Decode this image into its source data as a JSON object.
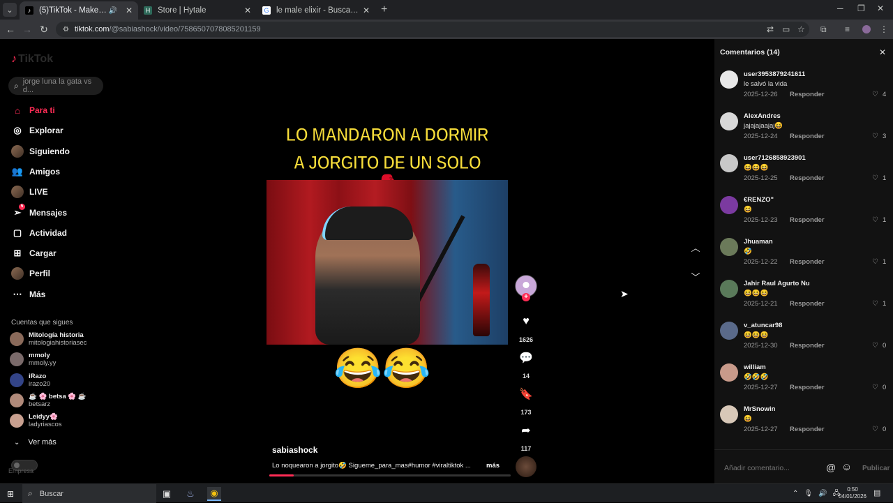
{
  "browser": {
    "tabs": [
      {
        "title": "(5)TikTok - Make Your Day",
        "fav": "♪",
        "fav_color": "#000000",
        "active": true,
        "audio": true
      },
      {
        "title": "Store | Hytale",
        "fav": "H",
        "fav_color": "#2e6a5a",
        "active": false
      },
      {
        "title": "le male elixir - Buscar con Goog",
        "fav": "G",
        "fav_color": "#ffffff",
        "active": false
      }
    ],
    "url_domain": "tiktok.com",
    "url_path": "/@sabiashock/video/7586507078085201159"
  },
  "sidebar": {
    "logo": "TikTok",
    "search_placeholder": "jorge luna la gata vs d...",
    "nav": [
      {
        "label": "Para ti",
        "icon": "home-icon",
        "active": true
      },
      {
        "label": "Explorar",
        "icon": "compass-icon"
      },
      {
        "label": "Siguiendo",
        "icon": "following-avatar-icon"
      },
      {
        "label": "Amigos",
        "icon": "friends-icon"
      },
      {
        "label": "LIVE",
        "icon": "live-avatar-icon"
      },
      {
        "label": "Mensajes",
        "icon": "messages-icon",
        "badge": "5"
      },
      {
        "label": "Actividad",
        "icon": "activity-icon"
      },
      {
        "label": "Cargar",
        "icon": "upload-icon"
      },
      {
        "label": "Perfil",
        "icon": "profile-avatar-icon"
      },
      {
        "label": "Más",
        "icon": "more-icon"
      }
    ],
    "following_title": "Cuentas que sigues",
    "following": [
      {
        "name": "Mitología historia",
        "handle": "mitologiahistoriasec"
      },
      {
        "name": "mmoly",
        "handle": "mmoly.yy"
      },
      {
        "name": "iRazo",
        "handle": "irazo20"
      },
      {
        "name": "☕ 🌸 betsa 🌸 ☕",
        "handle": "betsarz"
      },
      {
        "name": "Leidyy🌸",
        "handle": "ladyriascos"
      }
    ],
    "see_more": "Ver más",
    "footer": "Empresa"
  },
  "video": {
    "caption_line1": "LO MANDARON A DORMIR",
    "caption_line2": "A JORGITO DE UN SOLO 🥊",
    "emoji": "😂😂",
    "author": "sabiashock",
    "description": "Lo noquearon a jorgito🤣 Sigueme_para_mas#humor #viraltiktok ...",
    "more": "más",
    "likes": "1626",
    "comments": "14",
    "saves": "173",
    "shares": "117",
    "progress": 0.1
  },
  "comments": {
    "title": "Comentarios (14)",
    "items": [
      {
        "user": "user3953879241611",
        "text": "le salvó la vida",
        "date": "2025-12-26",
        "likes": "4",
        "avatar_color": "#e8e8e8"
      },
      {
        "user": "AlexAndres",
        "text": "jajajajaajaj😆",
        "date": "2025-12-24",
        "likes": "3",
        "avatar_color": "#d8d8d8"
      },
      {
        "user": "user7126858923901",
        "text": "😆😆😆",
        "date": "2025-12-25",
        "likes": "1",
        "avatar_color": "#c8c8c8"
      },
      {
        "user": "€RENZO\"",
        "text": "😆",
        "date": "2025-12-23",
        "likes": "1",
        "avatar_color": "#7b3aa0"
      },
      {
        "user": "Jhuaman",
        "text": "🤣",
        "date": "2025-12-22",
        "likes": "1",
        "avatar_color": "#6b7a5a"
      },
      {
        "user": "Jahir Raul Agurto Nu",
        "text": "😆😆😆",
        "date": "2025-12-21",
        "likes": "1",
        "avatar_color": "#5a7a5a"
      },
      {
        "user": "v_atuncar98",
        "text": "😆😆😆",
        "date": "2025-12-30",
        "likes": "0",
        "avatar_color": "#5a6a8a"
      },
      {
        "user": "william",
        "text": "🤣🤣🤣",
        "date": "2025-12-27",
        "likes": "0",
        "avatar_color": "#c89a8a"
      },
      {
        "user": "MrSnowin",
        "text": "😆",
        "date": "2025-12-27",
        "likes": "0",
        "avatar_color": "#d8c8b8"
      }
    ],
    "reply_label": "Responder",
    "input_placeholder": "Añadir comentario...",
    "publish": "Publicar"
  },
  "taskbar": {
    "search": "Buscar",
    "time": "0:50",
    "date": "04/01/2026"
  }
}
